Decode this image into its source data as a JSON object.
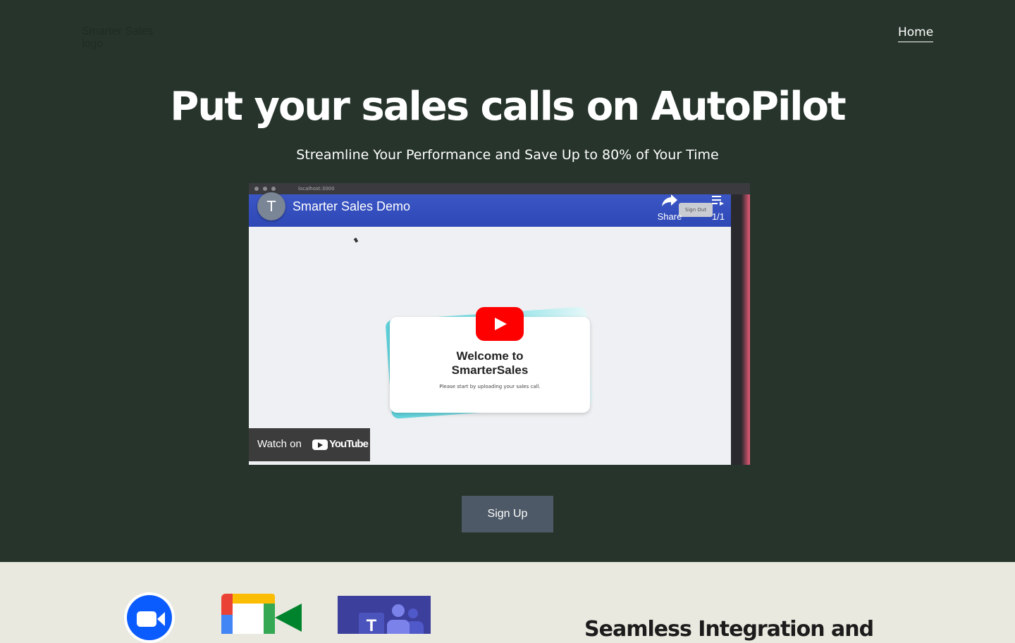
{
  "header": {
    "logo_alt": "Smarter Sales logo",
    "nav": {
      "home": "Home"
    }
  },
  "hero": {
    "title": "Put your sales calls on AutoPilot",
    "subtitle": "Streamline Your Performance and Save Up to 80% of Your Time",
    "signup_label": "Sign Up"
  },
  "video": {
    "channel_initial": "T",
    "title": "Smarter Sales Demo",
    "share_label": "Share",
    "playlist_count": "1/1",
    "watch_on": "Watch on",
    "youtube_word": "YouTube",
    "inner": {
      "url": "localhost:3000",
      "sign_out": "Sign Out",
      "card_title_line1": "Welcome to",
      "card_title_line2": "SmarterSales",
      "card_text": "Please start by uploading your sales call."
    }
  },
  "integrations": {
    "heading": "Seamless Integration and",
    "logos": [
      "zoom-logo",
      "google-meet-logo",
      "microsoft-teams-logo"
    ]
  },
  "colors": {
    "hero_bg": "#26342b",
    "section_bg": "#e9e9df",
    "button_bg": "#4d5966",
    "youtube_red": "#ff0000"
  }
}
